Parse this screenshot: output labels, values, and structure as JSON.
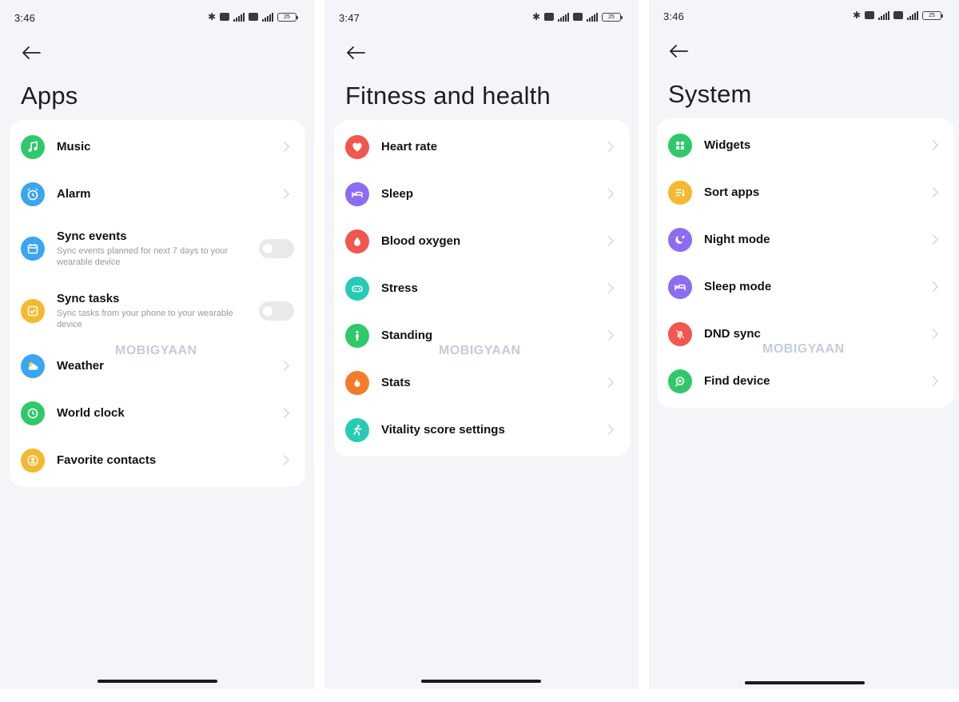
{
  "screens": [
    {
      "id": "apps",
      "time": "3:46",
      "battery": "25",
      "title": "Apps",
      "watermark": "MOBIGYAAN",
      "items": [
        {
          "label": "Music",
          "icon": "music-note-icon",
          "color": "#2fc96a"
        },
        {
          "label": "Alarm",
          "icon": "alarm-clock-icon",
          "color": "#3aa5f0"
        },
        {
          "label": "Sync events",
          "sub": "Sync events planned for next 7 days to your wearable device",
          "icon": "calendar-icon",
          "color": "#3aa5f0",
          "toggle": "off"
        },
        {
          "label": "Sync tasks",
          "sub": "Sync tasks from your phone to your wearable device",
          "icon": "checkbox-icon",
          "color": "#f5b82e",
          "toggle": "off"
        },
        {
          "label": "Weather",
          "icon": "weather-icon",
          "color": "#3aa5f0"
        },
        {
          "label": "World clock",
          "icon": "clock-icon",
          "color": "#2fc96a"
        },
        {
          "label": "Favorite contacts",
          "icon": "contact-icon",
          "color": "#f5b82e"
        }
      ]
    },
    {
      "id": "fitness",
      "time": "3:47",
      "battery": "25",
      "title": "Fitness and health",
      "watermark": "MOBIGYAAN",
      "items": [
        {
          "label": "Heart rate",
          "icon": "heart-icon",
          "color": "#f2564d"
        },
        {
          "label": "Sleep",
          "icon": "bed-icon",
          "color": "#8c6cf0"
        },
        {
          "label": "Blood oxygen",
          "icon": "droplet-icon",
          "color": "#f2564d"
        },
        {
          "label": "Stress",
          "icon": "stress-icon",
          "color": "#26cbb5"
        },
        {
          "label": "Standing",
          "icon": "standing-person-icon",
          "color": "#2fc96a"
        },
        {
          "label": "Stats",
          "icon": "flame-icon",
          "color": "#f57a2a"
        },
        {
          "label": "Vitality score settings",
          "icon": "running-person-icon",
          "color": "#26cbb5"
        }
      ]
    },
    {
      "id": "system",
      "time": "3:46",
      "battery": "25",
      "title": "System",
      "watermark": "MOBIGYAAN",
      "items": [
        {
          "label": "Widgets",
          "icon": "widgets-grid-icon",
          "color": "#2fc96a"
        },
        {
          "label": "Sort apps",
          "icon": "sort-list-icon",
          "color": "#f5b82e"
        },
        {
          "label": "Night mode",
          "icon": "moon-icon",
          "color": "#8c6cf0"
        },
        {
          "label": "Sleep mode",
          "icon": "bed-icon",
          "color": "#8c6cf0"
        },
        {
          "label": "DND sync",
          "icon": "bell-off-icon",
          "color": "#f2564d"
        },
        {
          "label": "Find device",
          "icon": "find-device-icon",
          "color": "#2fc96a"
        }
      ]
    }
  ]
}
